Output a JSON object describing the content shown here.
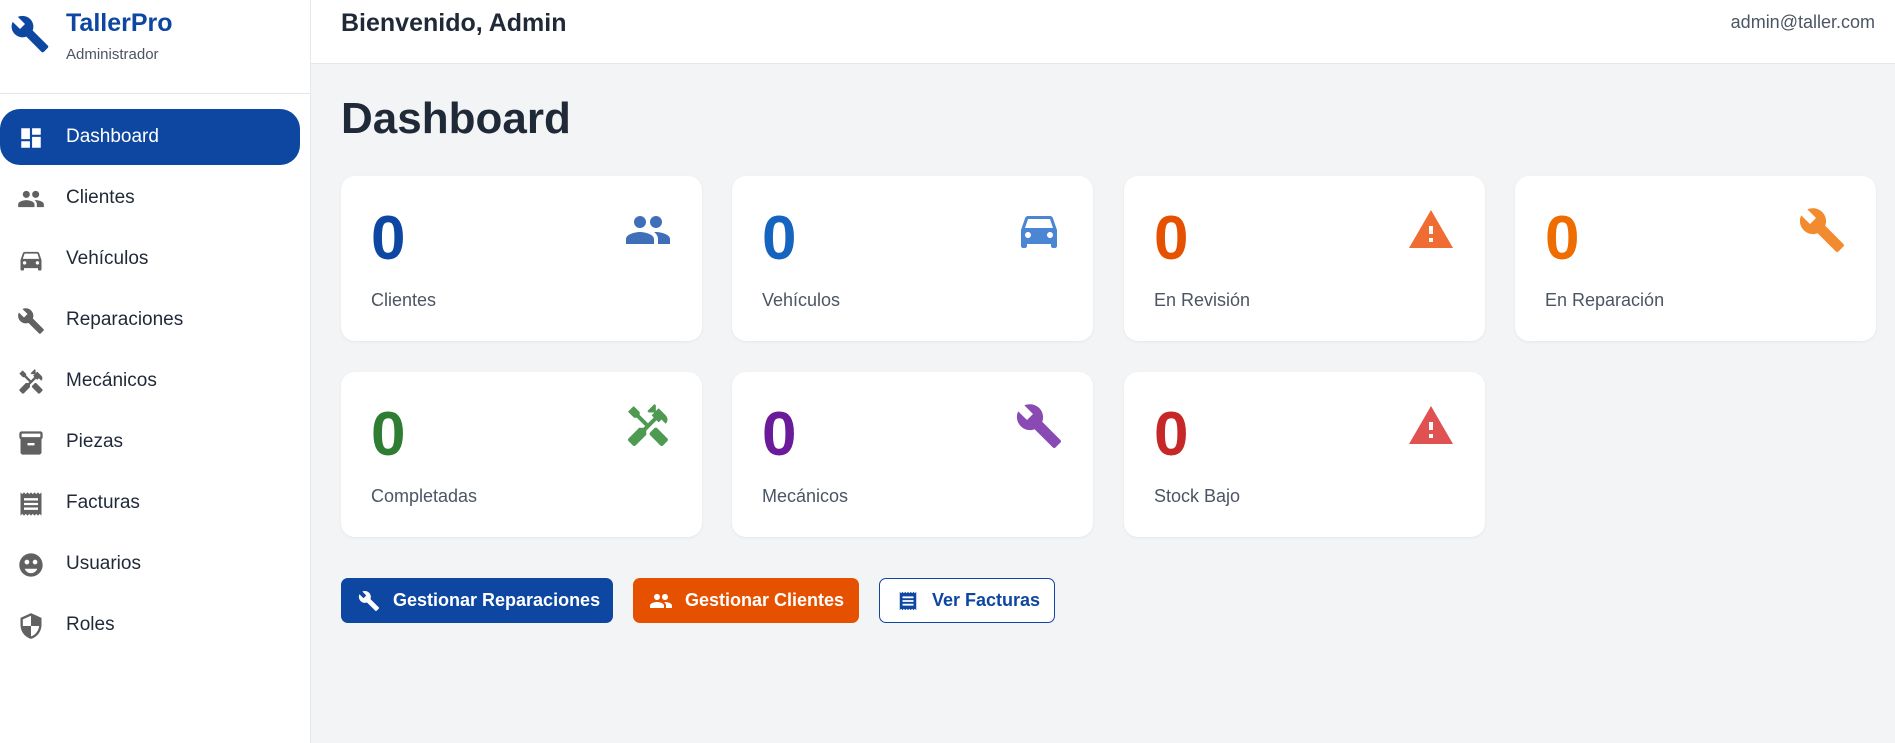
{
  "brand": {
    "name": "TallerPro",
    "role": "Administrador",
    "icon": "wrench-icon"
  },
  "nav": [
    {
      "label": "Dashboard",
      "icon": "dashboard-icon",
      "active": true
    },
    {
      "label": "Clientes",
      "icon": "people-icon"
    },
    {
      "label": "Vehículos",
      "icon": "car-icon"
    },
    {
      "label": "Reparaciones",
      "icon": "wrench-icon"
    },
    {
      "label": "Mecánicos",
      "icon": "tools-icon"
    },
    {
      "label": "Piezas",
      "icon": "archive-icon"
    },
    {
      "label": "Facturas",
      "icon": "receipt-icon"
    },
    {
      "label": "Usuarios",
      "icon": "face-icon"
    },
    {
      "label": "Roles",
      "icon": "shield-icon"
    }
  ],
  "topbar": {
    "welcome": "Bienvenido, Admin",
    "email": "admin@taller.com"
  },
  "page": {
    "title": "Dashboard"
  },
  "cards": [
    {
      "value": "0",
      "label": "Clientes",
      "icon": "people-icon",
      "color": "#0d47a1",
      "icon_color": "#3e6fb8"
    },
    {
      "value": "0",
      "label": "Vehículos",
      "icon": "car-icon",
      "color": "#1565c0",
      "icon_color": "#4a86d4"
    },
    {
      "value": "0",
      "label": "En Revisión",
      "icon": "warning-icon",
      "color": "#e65100",
      "icon_color": "#ef6c33"
    },
    {
      "value": "0",
      "label": "En Reparación",
      "icon": "wrench-icon",
      "color": "#ef6c00",
      "icon_color": "#f28a30"
    },
    {
      "value": "0",
      "label": "Completadas",
      "icon": "tools-icon",
      "color": "#2e7d32",
      "icon_color": "#4e9a52"
    },
    {
      "value": "0",
      "label": "Mecánicos",
      "icon": "wrench-icon",
      "color": "#6a1b9a",
      "icon_color": "#8a4ab4"
    },
    {
      "value": "0",
      "label": "Stock Bajo",
      "icon": "warning-icon",
      "color": "#c62828",
      "icon_color": "#e05252"
    }
  ],
  "actions": {
    "repairs": {
      "label": "Gestionar Reparaciones",
      "icon": "wrench-icon"
    },
    "clients": {
      "label": "Gestionar Clientes",
      "icon": "people-icon"
    },
    "invoices": {
      "label": "Ver Facturas",
      "icon": "receipt-icon"
    }
  }
}
